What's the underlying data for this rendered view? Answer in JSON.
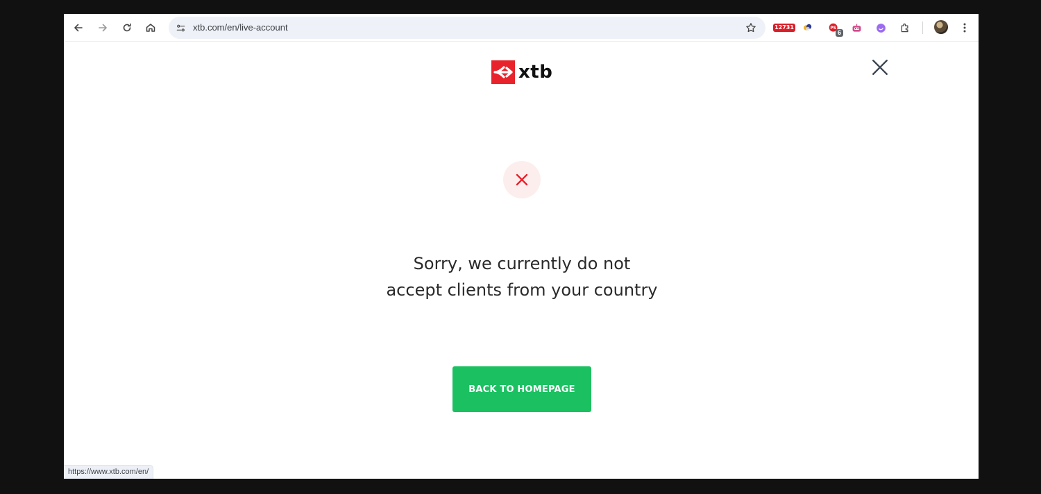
{
  "browser": {
    "url": "xtb.com/en/live-account",
    "status_url": "https://www.xtb.com/en/",
    "extensions": [
      {
        "icon": "calendar-extension-icon",
        "badge": "12731"
      },
      {
        "icon": "color-picker-extension-icon"
      },
      {
        "icon": "red-extension-icon",
        "badge": "6"
      },
      {
        "icon": "robot-extension-icon"
      },
      {
        "icon": "purple-extension-icon"
      },
      {
        "icon": "puzzle-extensions-icon"
      }
    ]
  },
  "page": {
    "logo_text": "xtb",
    "message": "Sorry, we currently do not accept clients from your country",
    "button_label": "BACK TO HOMEPAGE"
  },
  "colors": {
    "brand_red": "#e8232b",
    "cta_green": "#1bc161",
    "error_bg": "#fdeeee"
  }
}
